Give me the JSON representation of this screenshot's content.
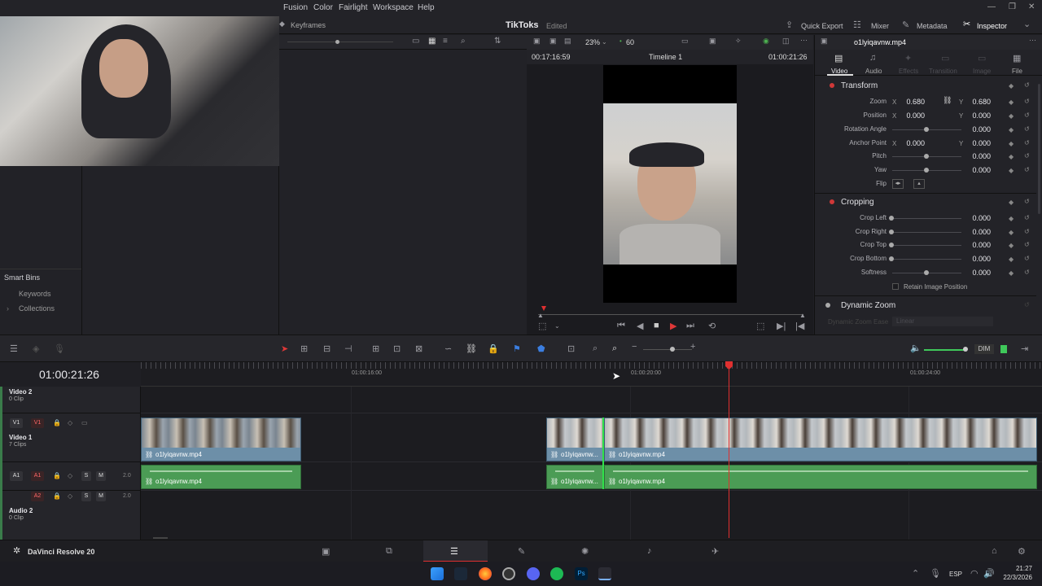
{
  "menu": {
    "items": [
      "Fusion",
      "Color",
      "Fairlight",
      "Workspace",
      "Help"
    ]
  },
  "toolbar": {
    "keyframes": "Keyframes",
    "project_name": "TikToks",
    "edited": "Edited",
    "quick_export": "Quick Export",
    "mixer": "Mixer",
    "metadata": "Metadata",
    "inspector": "Inspector"
  },
  "viewer": {
    "zoom": "23%",
    "fps": "60",
    "src_timecode": "00:17:16:59",
    "timeline_name": "Timeline 1",
    "rec_timecode": "01:00:21:26",
    "clip_name": "o1lyiqavnw.mp4"
  },
  "inspector_tabs": {
    "video": "Video",
    "audio": "Audio",
    "effects": "Effects",
    "transition": "Transition",
    "image": "Image",
    "file": "File"
  },
  "transform": {
    "title": "Transform",
    "zoom_label": "Zoom",
    "zoom_x": "0.680",
    "zoom_y": "0.680",
    "position_label": "Position",
    "pos_x": "0.000",
    "pos_y": "0.000",
    "rotation_label": "Rotation Angle",
    "rotation": "0.000",
    "anchor_label": "Anchor Point",
    "anchor_x": "0.000",
    "anchor_y": "0.000",
    "pitch_label": "Pitch",
    "pitch": "0.000",
    "yaw_label": "Yaw",
    "yaw": "0.000",
    "flip_label": "Flip",
    "x": "X",
    "y": "Y"
  },
  "cropping": {
    "title": "Cropping",
    "left_label": "Crop Left",
    "left": "0.000",
    "right_label": "Crop Right",
    "right": "0.000",
    "top_label": "Crop Top",
    "top": "0.000",
    "bottom_label": "Crop Bottom",
    "bottom": "0.000",
    "softness_label": "Softness",
    "softness": "0.000",
    "retain_label": "Retain Image Position"
  },
  "dynamic_zoom": {
    "title": "Dynamic Zoom",
    "ease_label": "Dynamic Zoom Ease",
    "ease_value": "Linear"
  },
  "smart_bins": {
    "title": "Smart Bins",
    "keywords": "Keywords",
    "collections": "Collections"
  },
  "timeline": {
    "timecode": "01:00:21:26",
    "ruler": [
      "01:00:16:00",
      "01:00:20:00",
      "01:00:24:00"
    ],
    "dim": "DIM",
    "tracks": {
      "video2": {
        "name": "Video 2",
        "sub": "0 Clip"
      },
      "video1": {
        "name": "Video 1",
        "sub": "7 Clips",
        "tag_left": "V1",
        "tag_right": "V1"
      },
      "a1": {
        "tag_left": "A1",
        "tag_right": "A1",
        "ch": "2.0",
        "s": "S",
        "m": "M"
      },
      "a2": {
        "tag": "A2",
        "ch": "2.0",
        "s": "S",
        "m": "M"
      },
      "audio2": {
        "name": "Audio 2",
        "sub": "0 Clip"
      }
    },
    "clip_names": {
      "full": "o1lyiqavnw.mp4",
      "short": "o1lyiqavnw..."
    }
  },
  "app": {
    "name": "DaVinci Resolve 20"
  },
  "taskbar": {
    "lang": "ESP",
    "time": "21:27",
    "date": "22/3/2026"
  }
}
